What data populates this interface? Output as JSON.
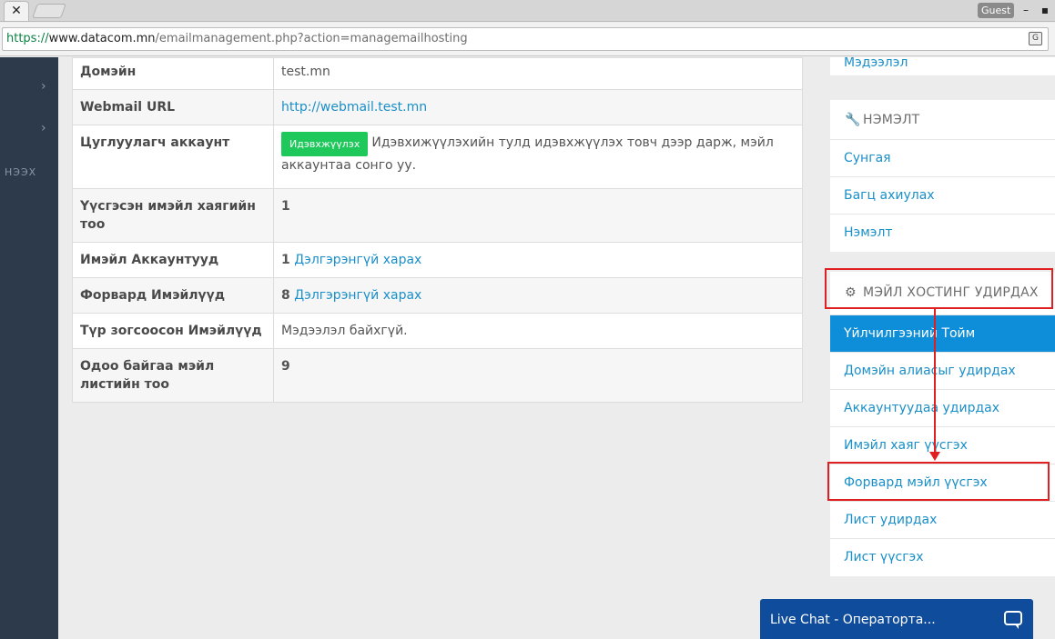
{
  "browser": {
    "tab_close": "✕",
    "guest_label": "Guest",
    "url_scheme": "https://",
    "url_host": "www.datacom.mn",
    "url_path": "/emailmanagement.php?action=managemailhosting",
    "minimize": "–",
    "close": "✕"
  },
  "leftnav": {
    "text": "НЭЭХ"
  },
  "table": {
    "rows": [
      {
        "label": "Домэйн",
        "value": "test.mn"
      },
      {
        "label": "Webmail URL",
        "link": "http://webmail.test.mn"
      },
      {
        "label": "Цуглуулагч аккаунт",
        "button": "Идэвхжүүлэх",
        "text": "Идэвхижүүлэхийн тулд идэвхжүүлэх товч дээр дарж, мэйл аккаунтаа сонго уу."
      },
      {
        "label": "Үүсгэсэн имэйл хаягийн тоо",
        "value": "1"
      },
      {
        "label": "Имэйл Аккаунтууд",
        "value": "1",
        "link": "Дэлгэрэнгүй харах"
      },
      {
        "label": "Форвард Имэйлүүд",
        "value": "8",
        "link": "Дэлгэрэнгүй харах"
      },
      {
        "label": "Түр зогсоосон Имэйлүүд",
        "value": "Мэдээлэл байхгүй."
      },
      {
        "label": "Одоо байгаа мэйл листийн тоо",
        "value": "9"
      }
    ]
  },
  "sidebar": {
    "top_item": "Мэдээлэл",
    "tools": {
      "title": "НЭМЭЛТ",
      "icon": "wrench-icon",
      "items": [
        "Сунгая",
        "Багц ахиулах",
        "Нэмэлт"
      ]
    },
    "mail": {
      "title": "МЭЙЛ ХОСТИНГ УДИРДАХ",
      "icon": "gear-icon",
      "items": [
        "Үйлчилгээний Тойм",
        "Домэйн алиасыг удирдах",
        "Аккаунтуудаа удирдах",
        "Имэйл хаяг үүсгэх",
        "Форвард мэйл үүсгэх",
        "Лист удирдах",
        "Лист үүсгэх"
      ]
    }
  },
  "livechat": {
    "label": "Live Chat - Оператортa..."
  },
  "colors": {
    "accent": "#1a8fc8",
    "active": "#0e8ed9",
    "annotation": "#e02020",
    "livechat": "#0f4c9b"
  }
}
